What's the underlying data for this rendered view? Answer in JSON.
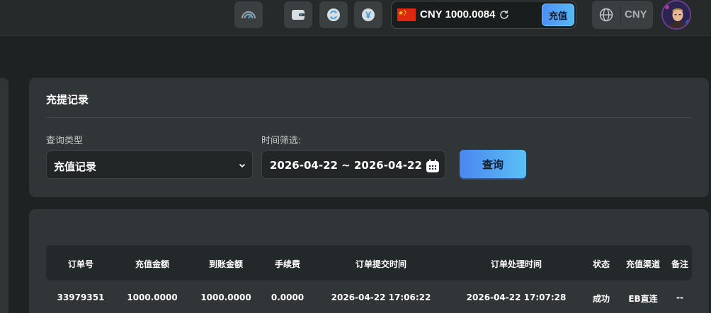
{
  "topbar": {
    "icons": [
      "speedometer-icon",
      "wallet-icon",
      "exchange-icon",
      "yen-icon"
    ],
    "balance": {
      "flag": "china-flag",
      "text": "CNY 1000.0084"
    },
    "deposit_label": "充值",
    "currency_label": "CNY"
  },
  "filter": {
    "title": "充提记录",
    "type_label": "查询类型",
    "type_value": "充值记录",
    "time_label": "时间筛选:",
    "date_range": "2026-04-22 ~ 2026-04-22",
    "query_label": "查询"
  },
  "table": {
    "columns": [
      "订单号",
      "充值金额",
      "到账金额",
      "手续费",
      "订单提交时间",
      "订单处理时间",
      "状态",
      "充值渠道",
      "备注"
    ],
    "rows": [
      [
        "33979351",
        "1000.0000",
        "1000.0000",
        "0.0000",
        "2026-04-22 17:06:22",
        "2026-04-22 17:07:28",
        "成功",
        "EB直连",
        "--"
      ]
    ]
  },
  "colors": {
    "accent_blue": "#4c8ff6",
    "accent_cyan": "#57b8f0",
    "panel": "#303637",
    "background": "#1e2223"
  }
}
